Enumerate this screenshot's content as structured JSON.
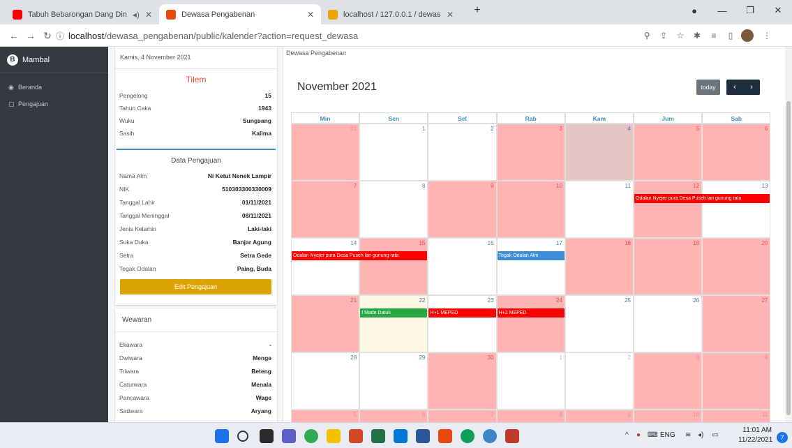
{
  "browser": {
    "tabs": [
      {
        "title": "Tabuh Bebarongan Dang Din",
        "icon_color": "#ff0000",
        "icon": "youtube-icon",
        "active": false
      },
      {
        "title": "Dewasa Pengabenan",
        "icon_color": "#e8490f",
        "icon": "app-icon",
        "active": true
      },
      {
        "title": "localhost / 127.0.0.1 / dewasa_pe",
        "icon_color": "#f0a500",
        "icon": "phpmyadmin-icon",
        "active": false
      }
    ],
    "new_tab": "+",
    "url_host": "localhost",
    "url_path": "/dewasa_pengabenan/public/kalender?action=request_dewasa"
  },
  "sidebar": {
    "brand": "Mambal",
    "items": [
      {
        "label": "Beranda",
        "icon": "dashboard-icon"
      },
      {
        "label": "Pengajuan",
        "icon": "document-icon"
      }
    ]
  },
  "date_card": {
    "date": "Kamis, 4 November 2021",
    "highlight": "Tilem",
    "rows": [
      {
        "label": "Pengelong",
        "value": "15"
      },
      {
        "label": "Tahun Caka",
        "value": "1943"
      },
      {
        "label": "Wuku",
        "value": "Sungsang"
      },
      {
        "label": "Sasih",
        "value": "Kalima"
      }
    ],
    "data_title": "Data Pengajuan",
    "data_rows": [
      {
        "label": "Nama Alm",
        "value": "Ni Ketut Nenek Lampir"
      },
      {
        "label": "NIK",
        "value": "510303300330009"
      },
      {
        "label": "Tanggal Lahir",
        "value": "01/11/2021"
      },
      {
        "label": "Tanggal Meninggal",
        "value": "08/11/2021"
      },
      {
        "label": "Jenis Kelamin",
        "value": "Laki-laki"
      },
      {
        "label": "Suka Duka",
        "value": "Banjar Agung"
      },
      {
        "label": "Setra",
        "value": "Setra Gede"
      },
      {
        "label": "Tegak Odalan",
        "value": "Paing, Buda"
      }
    ],
    "edit_button": "Edit Pengajuan"
  },
  "wewaran": {
    "title": "Wewaran",
    "rows": [
      {
        "label": "Ekawara",
        "value": "-"
      },
      {
        "label": "Dwiwara",
        "value": "Menge"
      },
      {
        "label": "Triwara",
        "value": "Beteng"
      },
      {
        "label": "Caturwara",
        "value": "Menala"
      },
      {
        "label": "Pancawara",
        "value": "Wage"
      },
      {
        "label": "Sadwara",
        "value": "Aryang"
      }
    ]
  },
  "calendar": {
    "header_small": "Dewasa Pengabenan",
    "title": "November 2021",
    "today_button": "today",
    "prev": "‹",
    "next": "›",
    "weekdays": [
      "Min",
      "Sen",
      "Sel",
      "Rab",
      "Kam",
      "Jum",
      "Sab"
    ],
    "weeks": [
      [
        {
          "d": "31",
          "s": "red",
          "o": true
        },
        {
          "d": "1",
          "s": "white"
        },
        {
          "d": "2",
          "s": "white"
        },
        {
          "d": "3",
          "s": "red"
        },
        {
          "d": "4",
          "s": "today"
        },
        {
          "d": "5",
          "s": "red"
        },
        {
          "d": "6",
          "s": "red"
        }
      ],
      [
        {
          "d": "7",
          "s": "red"
        },
        {
          "d": "8",
          "s": "white"
        },
        {
          "d": "9",
          "s": "red"
        },
        {
          "d": "10",
          "s": "red"
        },
        {
          "d": "11",
          "s": "white"
        },
        {
          "d": "12",
          "s": "red"
        },
        {
          "d": "13",
          "s": "white"
        }
      ],
      [
        {
          "d": "14",
          "s": "white"
        },
        {
          "d": "15",
          "s": "red"
        },
        {
          "d": "16",
          "s": "white"
        },
        {
          "d": "17",
          "s": "white"
        },
        {
          "d": "18",
          "s": "red"
        },
        {
          "d": "19",
          "s": "red"
        },
        {
          "d": "20",
          "s": "red"
        }
      ],
      [
        {
          "d": "21",
          "s": "red"
        },
        {
          "d": "22",
          "s": "yellow"
        },
        {
          "d": "23",
          "s": "white"
        },
        {
          "d": "24",
          "s": "red"
        },
        {
          "d": "25",
          "s": "white"
        },
        {
          "d": "26",
          "s": "white"
        },
        {
          "d": "27",
          "s": "red"
        }
      ],
      [
        {
          "d": "28",
          "s": "white"
        },
        {
          "d": "29",
          "s": "white"
        },
        {
          "d": "30",
          "s": "red"
        },
        {
          "d": "1",
          "s": "white",
          "o": true
        },
        {
          "d": "2",
          "s": "white",
          "o": true
        },
        {
          "d": "3",
          "s": "red",
          "o": true
        },
        {
          "d": "4",
          "s": "red",
          "o": true
        }
      ],
      [
        {
          "d": "5",
          "s": "red",
          "o": true
        },
        {
          "d": "6",
          "s": "red",
          "o": true
        },
        {
          "d": "7",
          "s": "red",
          "o": true
        },
        {
          "d": "8",
          "s": "red",
          "o": true
        },
        {
          "d": "9",
          "s": "red",
          "o": true
        },
        {
          "d": "10",
          "s": "red",
          "o": true
        },
        {
          "d": "11",
          "s": "red",
          "o": true
        }
      ]
    ],
    "events": [
      {
        "title": "Odalan Nyejer pura Desa Puseh lan gunung rata",
        "week": 1,
        "col": 5,
        "span": 2,
        "color": "red"
      },
      {
        "title": "Odalan Nyejer pura Desa Puseh lan gunung rata",
        "week": 2,
        "col": 0,
        "span": 2,
        "color": "red"
      },
      {
        "title": "Tegak Odalan Alm",
        "week": 2,
        "col": 3,
        "span": 1,
        "color": "blue"
      },
      {
        "title": "I Made Datuk",
        "week": 3,
        "col": 1,
        "span": 1,
        "color": "green"
      },
      {
        "title": "H+1 MEPED",
        "week": 3,
        "col": 2,
        "span": 1,
        "color": "red"
      },
      {
        "title": "H+2 MEPED",
        "week": 3,
        "col": 3,
        "span": 1,
        "color": "red"
      }
    ]
  },
  "taskbar": {
    "tray_lang": "ENG",
    "time": "11:01 AM",
    "date": "11/22/2021",
    "notifications": "7"
  }
}
